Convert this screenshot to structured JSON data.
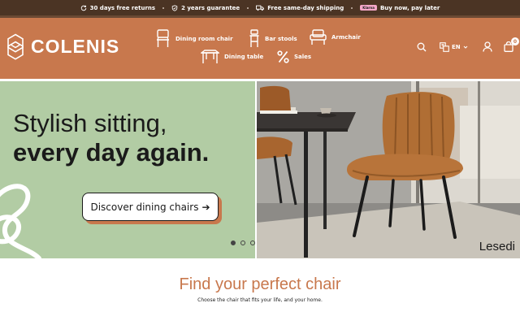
{
  "topbar": {
    "usps": [
      {
        "icon": "refresh-icon",
        "label": "30 days free returns"
      },
      {
        "icon": "shield-check-icon",
        "label": "2 years guarantee"
      },
      {
        "icon": "truck-icon",
        "label": "Free same-day shipping"
      },
      {
        "icon": "klarna-logo",
        "label": "Buy now, pay later",
        "badge": "Klarna"
      }
    ]
  },
  "header": {
    "logo": "COLENIS",
    "nav": [
      {
        "icon": "dining-chair-icon",
        "label": "Dining room chair"
      },
      {
        "icon": "bar-stool-icon",
        "label": "Bar stools"
      },
      {
        "icon": "armchair-icon",
        "label": "Armchair"
      },
      {
        "icon": "dining-table-icon",
        "label": "Dining table"
      },
      {
        "icon": "percent-icon",
        "label": "Sales"
      }
    ],
    "language": "EN",
    "cart_count": "0"
  },
  "hero": {
    "title_line1": "Stylish sitting,",
    "title_line2": "every day again.",
    "cta": "Discover dining chairs",
    "cta_arrow": "➔",
    "caption": "Lesedi",
    "slides": 3,
    "active_slide": 1
  },
  "section": {
    "title": "Find your perfect chair",
    "subtitle": "Choose the chair that fits your life, and your home."
  },
  "colors": {
    "brand": "#c8784d",
    "topbar": "#4b3424",
    "hero_green": "#b2cca4"
  }
}
